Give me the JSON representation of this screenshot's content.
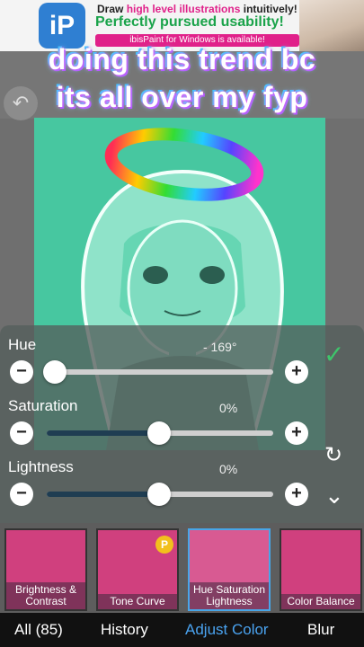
{
  "ad": {
    "line1_pre": "Draw",
    "line1_accent": "high level illustrations",
    "line1_post": "intuitively!",
    "line2": "Perfectly pursued usability!",
    "line3": "ibisPaint for Windows is available!",
    "logo_text": "iP"
  },
  "overlay": {
    "line1": "doing this trend bc",
    "line2": "its all over my fyp"
  },
  "sliders": [
    {
      "label": "Hue",
      "value_text": "- 169°",
      "minus": "−",
      "plus": "+",
      "fill_fraction": 0.0
    },
    {
      "label": "Saturation",
      "value_text": "0%",
      "minus": "−",
      "plus": "+",
      "fill_fraction": 0.5
    },
    {
      "label": "Lightness",
      "value_text": "0%",
      "minus": "−",
      "plus": "+",
      "fill_fraction": 0.5
    }
  ],
  "icons": {
    "undo": "↶",
    "check": "✓",
    "reset": "↻",
    "collapse": "⌄"
  },
  "filters": [
    {
      "caption": "Brightness & Contrast"
    },
    {
      "caption": "Tone Curve",
      "badge": "P"
    },
    {
      "caption": "Hue Saturation Lightness"
    },
    {
      "caption": "Color Balance"
    }
  ],
  "tabs": [
    "All (85)",
    "History",
    "Adjust Color",
    "Blur"
  ],
  "colors": {
    "canvas": "#47c7a0",
    "accent": "#4aa3f0",
    "slider_fill": "#1f3d52",
    "ad_pink": "#e0218a",
    "ad_green": "#1aa34a"
  }
}
